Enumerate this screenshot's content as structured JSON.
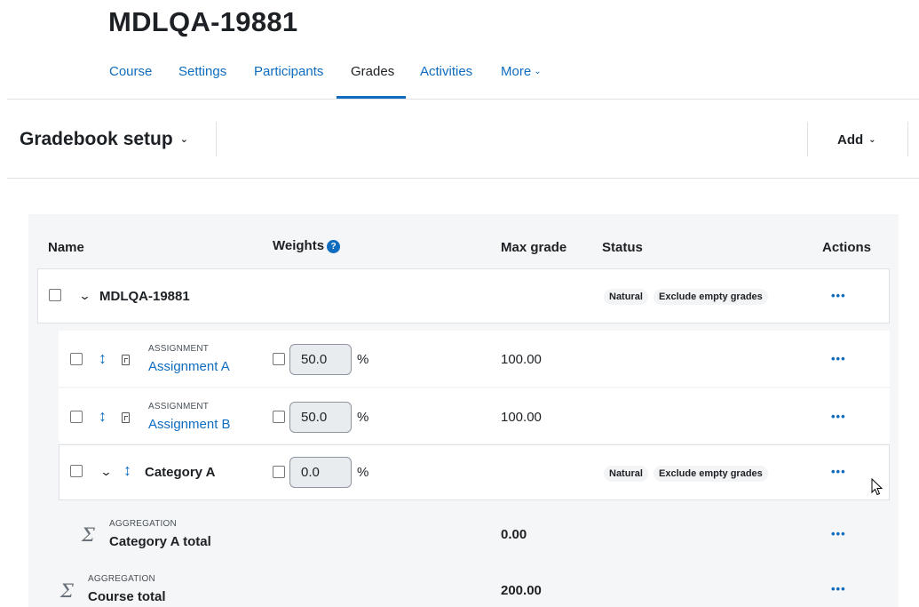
{
  "page": {
    "title": "MDLQA-19881"
  },
  "nav": {
    "tabs": [
      {
        "label": "Course"
      },
      {
        "label": "Settings"
      },
      {
        "label": "Participants"
      },
      {
        "label": "Grades",
        "active": true
      },
      {
        "label": "Activities"
      },
      {
        "label": "More"
      }
    ]
  },
  "header": {
    "title": "Gradebook setup",
    "add_label": "Add"
  },
  "table": {
    "columns": {
      "name": "Name",
      "weights": "Weights",
      "max_grade": "Max grade",
      "status": "Status",
      "actions": "Actions"
    },
    "course_row": {
      "name": "MDLQA-19881",
      "badges": [
        "Natural",
        "Exclude empty grades"
      ]
    },
    "items": [
      {
        "type_label": "ASSIGNMENT",
        "name": "Assignment A",
        "weight": "50.0",
        "pct": "%",
        "max_grade": "100.00"
      },
      {
        "type_label": "ASSIGNMENT",
        "name": "Assignment B",
        "weight": "50.0",
        "pct": "%",
        "max_grade": "100.00"
      }
    ],
    "category": {
      "name": "Category A",
      "weight": "0.0",
      "pct": "%",
      "badges": [
        "Natural",
        "Exclude empty grades"
      ]
    },
    "category_total": {
      "type_label": "AGGREGATION",
      "name": "Category A total",
      "max_grade": "0.00"
    },
    "course_total": {
      "type_label": "AGGREGATION",
      "name": "Course total",
      "max_grade": "200.00"
    },
    "actions_label": "•••"
  },
  "colors": {
    "link": "#0f6cbf",
    "text": "#1d2125",
    "panel_bg": "#f5f6f7"
  }
}
